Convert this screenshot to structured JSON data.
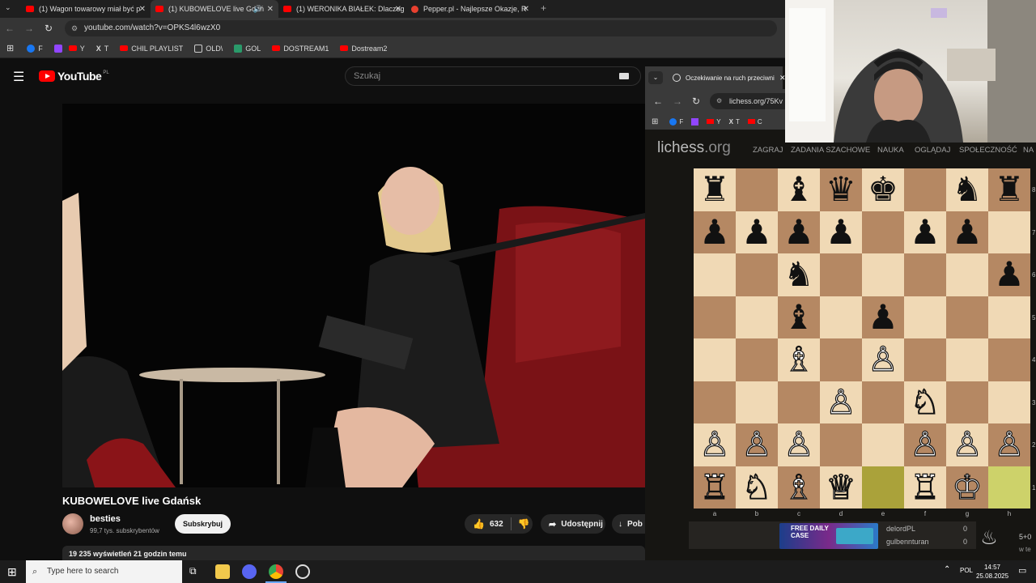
{
  "tabs": [
    {
      "title": "(1) Wagon towarowy miał być p",
      "active": false
    },
    {
      "title": "(1) KUBOWELOVE live Gdań",
      "active": true
    },
    {
      "title": "(1) WERONIKA BIAŁEK: Dlaczeg",
      "active": false
    },
    {
      "title": "Pepper.pl - Najlepsze Okazje, R",
      "active": false
    }
  ],
  "address": {
    "url": "youtube.com/watch?v=OPKS4l6wzX0"
  },
  "bookmarks": [
    "F",
    "Y",
    "T",
    "CHIL PLAYLIST",
    "OLD\\",
    "GOL",
    "DOSTREAM1",
    "Dostream2"
  ],
  "youtube": {
    "logo": "YouTube",
    "region": "PL",
    "search_placeholder": "Szukaj",
    "video_title": "KUBOWELOVE live Gdańsk",
    "channel": "besties",
    "subscribers": "99,7 tys. subskrybentów",
    "subscribe_label": "Subskrybuj",
    "likes": "632",
    "share_label": "Udostępnij",
    "download_label": "Pob",
    "views": "19 235 wyświetleń  21 godzin temu"
  },
  "lichess": {
    "tab_title": "Oczekiwanie na ruch przeciwni",
    "url": "lichess.org/75Kv",
    "bookmarks": [
      "F",
      "Y",
      "T",
      "C"
    ],
    "logo": "lichess",
    "logo_tld": ".org",
    "menu": [
      "ZAGRAJ",
      "ZADANIA SZACHOWE",
      "NAUKA",
      "OGLĄDAJ",
      "SPOŁECZNOŚĆ",
      "NA"
    ],
    "board": [
      [
        "br",
        "",
        "bb",
        "bq",
        "bk",
        "",
        "bn",
        "br"
      ],
      [
        "bp",
        "bp",
        "bp",
        "bp",
        "",
        "bp",
        "bp",
        ""
      ],
      [
        "",
        "",
        "bn",
        "",
        "",
        "",
        "",
        "bp"
      ],
      [
        "",
        "",
        "bb",
        "",
        "bp",
        "",
        "",
        ""
      ],
      [
        "",
        "",
        "wb",
        "",
        "wp",
        "",
        "",
        ""
      ],
      [
        "",
        "",
        "",
        "wp",
        "",
        "wn",
        "",
        ""
      ],
      [
        "wp",
        "wp",
        "wp",
        "",
        "",
        "wp",
        "wp",
        "wp"
      ],
      [
        "wr",
        "wn",
        "wb",
        "wq",
        "",
        "wr",
        "wk",
        ""
      ]
    ],
    "highlight_squares": [
      "e1",
      "h1"
    ],
    "files": [
      "a",
      "b",
      "c",
      "d",
      "e",
      "f",
      "g",
      "h"
    ],
    "ranks": [
      "8",
      "7",
      "6",
      "5",
      "4",
      "3",
      "2",
      "1"
    ],
    "banner_text": "FREE DAILY CASE",
    "players": [
      {
        "name": "delordPL",
        "score": "0"
      },
      {
        "name": "gulbennturan",
        "score": "0"
      }
    ],
    "time_control": "5+0",
    "time_sub": "w te"
  },
  "taskbar": {
    "search_placeholder": "Type here to search",
    "lang": "POL",
    "time": "14:57",
    "date": "25.08.2025"
  },
  "colors": {
    "youtube_red": "#ff0000",
    "board_light": "#f0d9b5",
    "board_dark": "#b58863",
    "highlight": "#aaa23a"
  }
}
